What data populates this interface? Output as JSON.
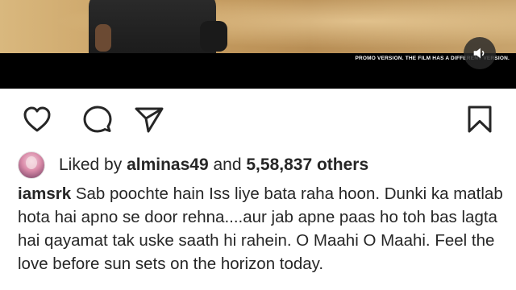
{
  "media": {
    "promo_text": "PROMO VERSION. THE FILM HAS A DIFFERENT VERSION.",
    "sound_icon": "speaker-muted-icon"
  },
  "actions": {
    "like_icon": "heart-icon",
    "comment_icon": "comment-icon",
    "share_icon": "send-icon",
    "save_icon": "bookmark-icon"
  },
  "likes": {
    "prefix": "Liked by",
    "user": "alminas49",
    "and_text": "and",
    "count": "5,58,837 others"
  },
  "caption": {
    "username": "iamsrk",
    "text": "Sab poochte hain Iss liye bata raha hoon. Dunki ka matlab hota hai apno se door rehna....aur jab apne paas ho toh bas lagta hai qayamat tak uske saath hi rahein. O Maahi O Maahi. Feel the love before sun sets on the horizon today."
  },
  "colors": {
    "text": "#262626",
    "background": "#ffffff",
    "media_bar": "#000000"
  }
}
